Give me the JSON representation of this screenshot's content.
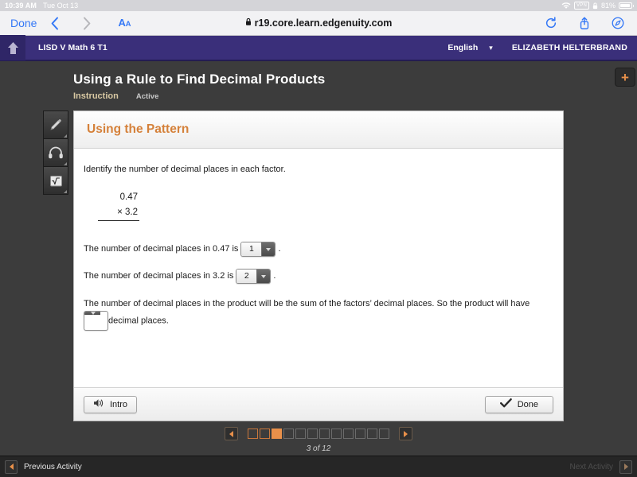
{
  "status_bar": {
    "time": "10:39 AM",
    "date": "Tue Oct 13",
    "vpn_label": "VPN",
    "battery_pct": "81%",
    "wifi_icon": "wifi-icon",
    "lock_icon": "lock-icon",
    "battery_icon": "battery-icon"
  },
  "safari": {
    "done_label": "Done",
    "back_icon": "chevron-left-icon",
    "forward_icon": "chevron-right-icon",
    "text_size_big": "A",
    "text_size_small": "A",
    "url": "r19.core.learn.edgenuity.com",
    "lock_icon": "lock-icon",
    "reload_icon": "reload-icon",
    "share_icon": "share-icon",
    "compass_icon": "compass-icon"
  },
  "app_header": {
    "home_icon": "home-icon",
    "course": "LISD V Math 6 T1",
    "language": "English",
    "language_caret": "chevron-down-icon",
    "user": "ELIZABETH HELTERBRAND"
  },
  "lesson": {
    "title": "Using a Rule to Find Decimal Products",
    "tab_instruction": "Instruction",
    "tab_active": "Active",
    "add_button_icon": "plus-icon"
  },
  "toolrail": {
    "items": [
      {
        "name": "pencil-icon",
        "label": "Pencil"
      },
      {
        "name": "headphones-icon",
        "label": "Audio"
      },
      {
        "name": "calculator-icon",
        "label": "Math tools"
      }
    ]
  },
  "card": {
    "header": "Using the Pattern",
    "intro": "Identify the number of decimal places in each factor.",
    "problem": {
      "factor1": "0.47",
      "operator": "×",
      "factor2": "3.2"
    },
    "question1_prefix": "The number of decimal places in 0.47 is",
    "question1_value": "1",
    "question1_suffix": ".",
    "question2_prefix": "The number of decimal places in 3.2 is",
    "question2_value": "2",
    "question2_suffix": ".",
    "paragraph_prefix": "The number of decimal places in the product will be the sum of the factors’ decimal places. So the product will have",
    "paragraph_value": "",
    "paragraph_suffix": "decimal places.",
    "dropdown_caret_icon": "caret-down-icon"
  },
  "card_footer": {
    "intro_label": "Intro",
    "intro_icon": "speaker-icon",
    "done_label": "Done",
    "done_icon": "check-icon"
  },
  "pager": {
    "prev_icon": "triangle-left-icon",
    "next_icon": "triangle-right-icon",
    "total": 12,
    "current": 3,
    "visited": 2,
    "label": "3 of 12",
    "accent_color": "#e8904a"
  },
  "activity_bar": {
    "prev_label": "Previous Activity",
    "prev_icon": "triangle-left-icon",
    "next_label": "Next Activity",
    "next_icon": "triangle-right-icon"
  }
}
